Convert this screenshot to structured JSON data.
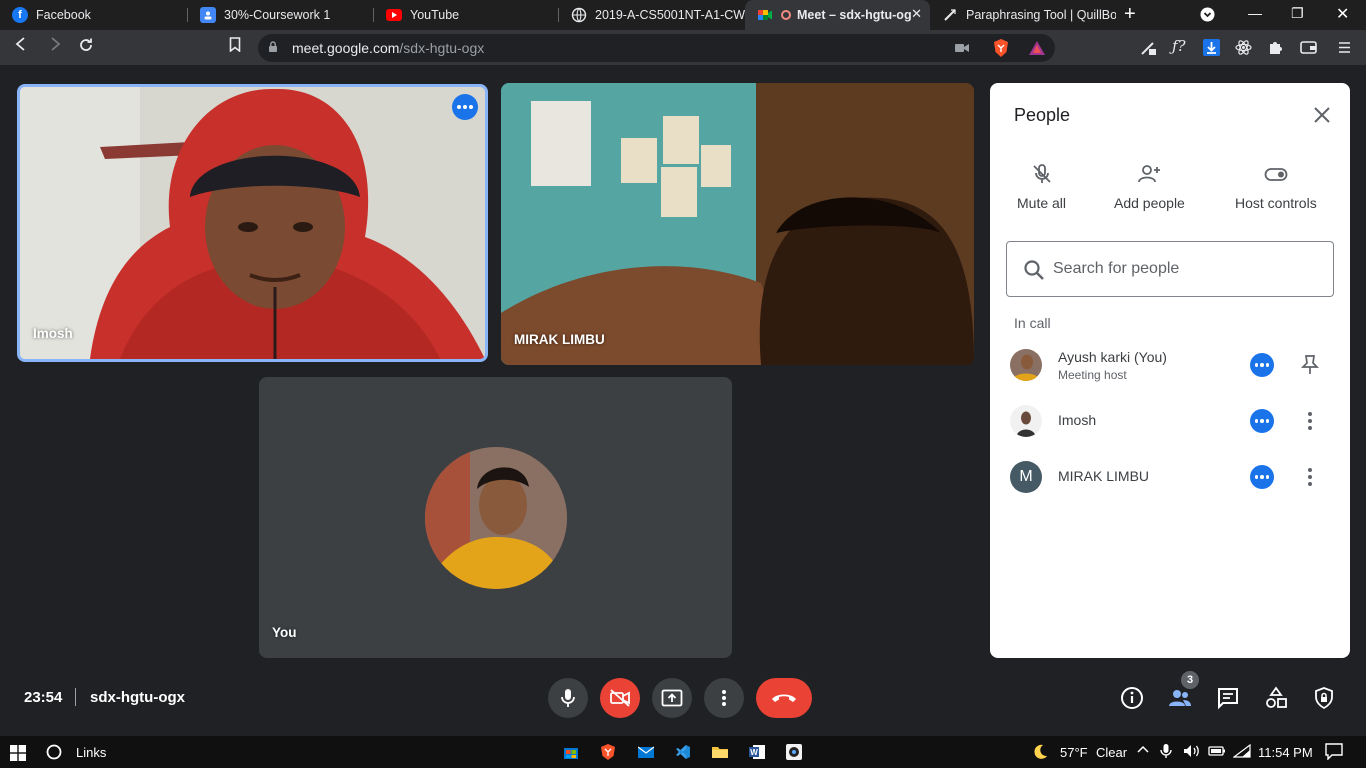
{
  "tabs": [
    {
      "label": "Facebook",
      "icon": "facebook-icon"
    },
    {
      "label": "30%-Coursework 1",
      "icon": "classroom-icon"
    },
    {
      "label": "YouTube",
      "icon": "youtube-icon"
    },
    {
      "label": "2019-A-CS5001NT-A1-CW-",
      "icon": "globe-icon"
    },
    {
      "label": "Meet – sdx-hgtu-og",
      "icon": "meet-icon",
      "active": true
    },
    {
      "label": "Paraphrasing Tool | QuillBot",
      "icon": "quillbot-icon"
    }
  ],
  "address": {
    "domain": "meet.google.com",
    "path": "/sdx-hgtu-ogx"
  },
  "tiles": {
    "imosh": {
      "name": "Imosh"
    },
    "mirak": {
      "name": "MIRAK LIMBU"
    },
    "you": {
      "name": "You"
    }
  },
  "people": {
    "title": "People",
    "actions": {
      "mute_all": "Mute all",
      "add_people": "Add people",
      "host_controls": "Host controls"
    },
    "search_placeholder": "Search for people",
    "section_label": "In call",
    "participants": [
      {
        "name": "Ayush karki (You)",
        "subtitle": "Meeting host"
      },
      {
        "name": "Imosh"
      },
      {
        "name": "MIRAK LIMBU",
        "initial": "M"
      }
    ]
  },
  "bottom": {
    "time": "23:54",
    "meeting_code": "sdx-hgtu-ogx",
    "participant_count": "3"
  },
  "taskbar": {
    "links_label": "Links",
    "temperature": "57°F",
    "weather": "Clear",
    "clock": "11:54 PM"
  },
  "colors": {
    "accent": "#1a73e8",
    "danger": "#ea4335",
    "active_border": "#8ab4f8"
  }
}
